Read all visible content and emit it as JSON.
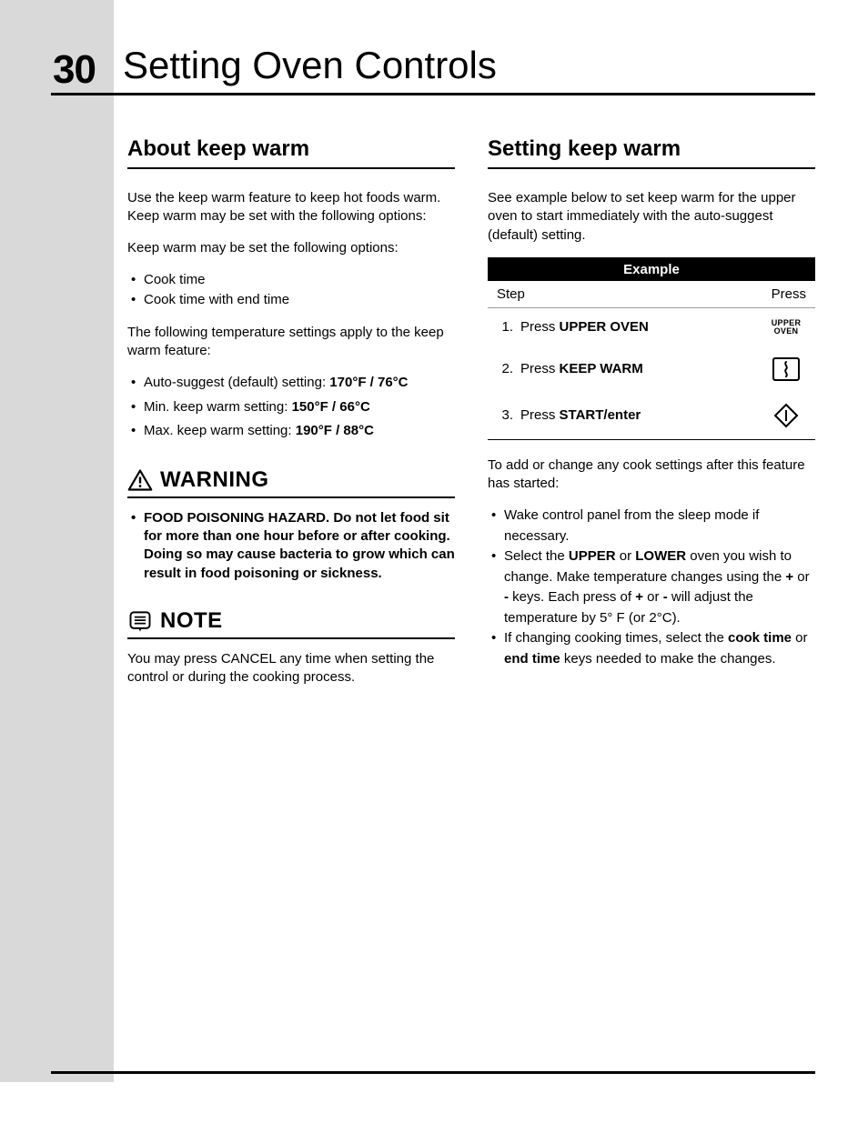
{
  "page_number": "30",
  "chapter_title": "Setting Oven Controls",
  "left": {
    "heading": "About keep warm",
    "intro": "Use the keep warm feature to keep hot foods warm. Keep warm may be set with the following options:",
    "options_lead": "Keep warm may be set the following options:",
    "options": [
      "Cook time",
      "Cook time with end time"
    ],
    "temp_lead": "The following temperature settings apply to the keep warm feature:",
    "temps": {
      "auto_label": "Auto-suggest (default) setting:",
      "auto_value": "170°F / 76°C",
      "min_label": "Min. keep warm setting:",
      "min_value": "150°F / 66°C",
      "max_label": "Max. keep warm setting:",
      "max_value": "190°F / 88°C"
    },
    "warning_label": "WARNING",
    "warning_text": "FOOD POISONING HAZARD. Do not let food sit for more than one hour before or after cooking. Doing so may cause bacteria to grow which can result in food poisoning or sickness.",
    "note_label": "NOTE",
    "note_text": "You may press CANCEL any time when setting the control or during the cooking process."
  },
  "right": {
    "heading": "Setting keep warm",
    "intro": "See example below to set keep warm for the upper oven to start immediately with the auto-suggest (default) setting.",
    "example_title": "Example",
    "col_step": "Step",
    "col_press": "Press",
    "steps": [
      {
        "num": "1.",
        "prefix": "Press ",
        "bold": "UPPER OVEN",
        "btn_line1": "UPPER",
        "btn_line2": "OVEN"
      },
      {
        "num": "2.",
        "prefix": "Press ",
        "bold": "KEEP WARM"
      },
      {
        "num": "3.",
        "prefix": "Press ",
        "bold": "START/enter"
      }
    ],
    "after_lead": "To add or change any cook settings after this feature has started:",
    "after_items": {
      "i0": "Wake control panel from the sleep mode if necessary.",
      "i1_a": "Select the ",
      "i1_b": "UPPER",
      "i1_c": " or ",
      "i1_d": "LOWER",
      "i1_e": " oven you wish to change. Make temperature changes using the ",
      "i1_f": "+",
      "i1_g": " or ",
      "i1_h": "-",
      "i1_i": " keys. Each press of ",
      "i1_j": "+",
      "i1_k": " or ",
      "i1_l": "-",
      "i1_m": " will adjust the temperature by 5° F (or 2°C).",
      "i2_a": "If changing cooking times, select the ",
      "i2_b": "cook time",
      "i2_c": " or ",
      "i2_d": "end time",
      "i2_e": " keys needed to make the changes."
    }
  }
}
